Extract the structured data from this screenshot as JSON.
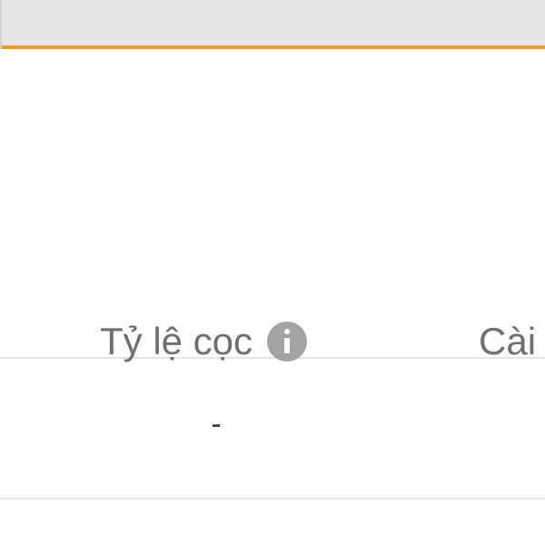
{
  "top_bar": {
    "accent_color": "#f39a1c",
    "background_color": "#e6e6e6"
  },
  "table": {
    "headers": {
      "deposit_ratio": "Tỷ lệ cọc",
      "settings": "Cài"
    },
    "rows": [
      {
        "deposit_ratio": "-"
      }
    ]
  },
  "icons": {
    "deposit_info": "info-icon"
  }
}
